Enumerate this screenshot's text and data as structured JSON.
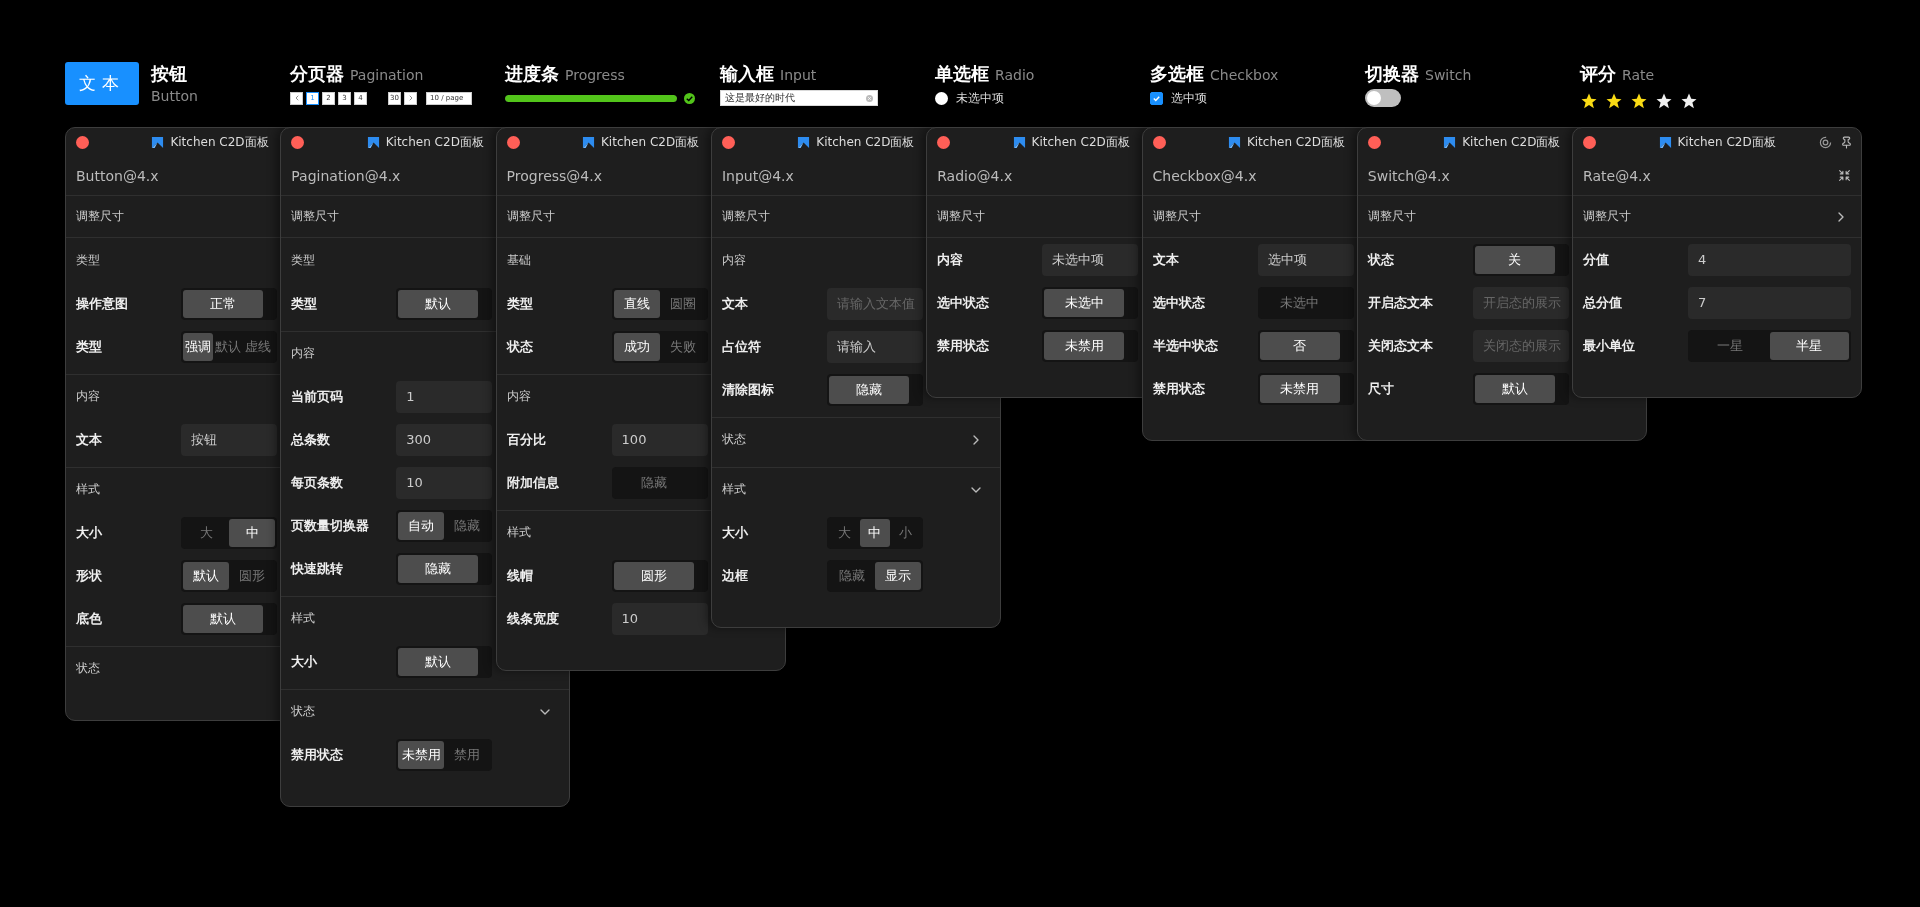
{
  "showcase": [
    {
      "kind": "button",
      "title": "按钮",
      "subtitle": "Button",
      "label": "文本"
    },
    {
      "kind": "pagination",
      "title": "分页器",
      "subtitle": "Pagination",
      "pages": [
        {
          "label": "1",
          "selected": true
        },
        {
          "label": "2",
          "selected": false
        },
        {
          "label": "3",
          "selected": false
        },
        {
          "label": "4",
          "selected": false
        },
        {
          "label": "30",
          "selected": false
        }
      ],
      "page_size": "10 / page"
    },
    {
      "kind": "progress",
      "title": "进度条",
      "subtitle": "Progress",
      "level": 1,
      "success": true
    },
    {
      "kind": "input",
      "title": "输入框",
      "subtitle": "Input",
      "value": "这是最好的时代"
    },
    {
      "kind": "radio",
      "title": "单选框",
      "subtitle": "Radio",
      "label": "未选中项",
      "checked": false
    },
    {
      "kind": "checkbox",
      "title": "多选框",
      "subtitle": "Checkbox",
      "label": "选中项",
      "checked": true
    },
    {
      "kind": "switch",
      "title": "切换器",
      "subtitle": "Switch",
      "on": false
    },
    {
      "kind": "rate",
      "title": "评分",
      "subtitle": "Rate",
      "stars": 3
    }
  ],
  "panels": [
    {
      "title": "Kitchen C2D面板",
      "component": "Button@4.x",
      "rows": [
        {
          "kind": "resize",
          "label": "调整尺寸"
        },
        {
          "kind": "group",
          "label": "类型"
        },
        {
          "kind": "segmented",
          "label": "操作意图",
          "options": [
            {
              "label": "正常",
              "selected": true
            }
          ]
        },
        {
          "kind": "chips",
          "label": "类型",
          "options": [
            {
              "label": "强调",
              "selected": true
            },
            {
              "label": "默认",
              "selected": false
            },
            {
              "label": "虚线",
              "selected": false
            }
          ]
        },
        {
          "kind": "group",
          "label": "内容"
        },
        {
          "kind": "field",
          "label": "文本",
          "value": "按钮"
        },
        {
          "kind": "group",
          "label": "样式"
        },
        {
          "kind": "segmented",
          "label": "大小",
          "options": [
            {
              "label": "大",
              "selected": false
            },
            {
              "label": "中",
              "selected": true
            }
          ]
        },
        {
          "kind": "segmented",
          "label": "形状",
          "options": [
            {
              "label": "默认",
              "selected": true
            },
            {
              "label": "圆形",
              "selected": false
            }
          ]
        },
        {
          "kind": "segmented",
          "label": "底色",
          "options": [
            {
              "label": "默认",
              "selected": true
            }
          ]
        },
        {
          "kind": "group",
          "label": "状态"
        }
      ]
    },
    {
      "title": "Kitchen C2D面板",
      "component": "Pagination@4.x",
      "rows": [
        {
          "kind": "resize",
          "label": "调整尺寸"
        },
        {
          "kind": "group",
          "label": "类型"
        },
        {
          "kind": "segmented",
          "label": "类型",
          "options": [
            {
              "label": "默认",
              "selected": true
            }
          ]
        },
        {
          "kind": "group",
          "label": "内容"
        },
        {
          "kind": "field",
          "label": "当前页码",
          "value": "1"
        },
        {
          "kind": "field",
          "label": "总条数",
          "value": "300"
        },
        {
          "kind": "field",
          "label": "每页条数",
          "value": "10"
        },
        {
          "kind": "segmented",
          "label": "页数量切换器",
          "options": [
            {
              "label": "自动",
              "selected": true
            },
            {
              "label": "隐藏",
              "selected": false
            }
          ]
        },
        {
          "kind": "segmented",
          "label": "快速跳转",
          "options": [
            {
              "label": "隐藏",
              "selected": true
            }
          ]
        },
        {
          "kind": "group",
          "label": "样式"
        },
        {
          "kind": "segmented",
          "label": "大小",
          "options": [
            {
              "label": "默认",
              "selected": true
            }
          ]
        },
        {
          "kind": "group",
          "label": "状态",
          "expanded": true
        },
        {
          "kind": "segmented",
          "label": "禁用状态",
          "options": [
            {
              "label": "未禁用",
              "selected": true
            },
            {
              "label": "禁用",
              "selected": false
            }
          ]
        }
      ]
    },
    {
      "title": "Kitchen C2D面板",
      "component": "Progress@4.x",
      "rows": [
        {
          "kind": "resize",
          "label": "调整尺寸"
        },
        {
          "kind": "group",
          "label": "基础"
        },
        {
          "kind": "segmented",
          "label": "类型",
          "options": [
            {
              "label": "直线",
              "selected": true
            },
            {
              "label": "圆圈",
              "selected": false
            }
          ]
        },
        {
          "kind": "segmented",
          "label": "状态",
          "options": [
            {
              "label": "成功",
              "selected": true
            },
            {
              "label": "失败",
              "selected": false
            }
          ]
        },
        {
          "kind": "group",
          "label": "内容"
        },
        {
          "kind": "field",
          "label": "百分比",
          "value": "100"
        },
        {
          "kind": "segmented",
          "label": "附加信息",
          "options": [
            {
              "label": "隐藏",
              "selected": false
            }
          ]
        },
        {
          "kind": "group",
          "label": "样式"
        },
        {
          "kind": "segmented",
          "label": "线帽",
          "options": [
            {
              "label": "圆形",
              "selected": true
            }
          ]
        },
        {
          "kind": "field",
          "label": "线条宽度",
          "value": "10"
        }
      ]
    },
    {
      "title": "Kitchen C2D面板",
      "component": "Input@4.x",
      "rows": [
        {
          "kind": "resize",
          "label": "调整尺寸"
        },
        {
          "kind": "group",
          "label": "内容"
        },
        {
          "kind": "field",
          "label": "文本",
          "placeholder": "请输入文本值"
        },
        {
          "kind": "field",
          "label": "占位符",
          "value": "请输入"
        },
        {
          "kind": "segmented",
          "label": "清除图标",
          "options": [
            {
              "label": "隐藏",
              "selected": true
            }
          ]
        },
        {
          "kind": "group",
          "label": "状态",
          "expanded": false
        },
        {
          "kind": "group",
          "label": "样式",
          "expanded": true
        },
        {
          "kind": "segmented",
          "label": "大小",
          "options": [
            {
              "label": "大",
              "selected": false
            },
            {
              "label": "中",
              "selected": true
            },
            {
              "label": "小",
              "selected": false
            }
          ]
        },
        {
          "kind": "segmented",
          "label": "边框",
          "options": [
            {
              "label": "隐藏",
              "selected": false
            },
            {
              "label": "显示",
              "selected": true
            }
          ]
        }
      ]
    },
    {
      "title": "Kitchen C2D面板",
      "component": "Radio@4.x",
      "rows": [
        {
          "kind": "resize",
          "label": "调整尺寸"
        },
        {
          "kind": "field",
          "label": "内容",
          "value": "未选中项"
        },
        {
          "kind": "segmented",
          "label": "选中状态",
          "options": [
            {
              "label": "未选中",
              "selected": true
            }
          ]
        },
        {
          "kind": "segmented",
          "label": "禁用状态",
          "options": [
            {
              "label": "未禁用",
              "selected": true
            }
          ]
        }
      ]
    },
    {
      "title": "Kitchen C2D面板",
      "component": "Checkbox@4.x",
      "rows": [
        {
          "kind": "resize",
          "label": "调整尺寸"
        },
        {
          "kind": "field",
          "label": "文本",
          "value": "选中项"
        },
        {
          "kind": "segmented",
          "label": "选中状态",
          "options": [
            {
              "label": "未选中",
              "selected": false
            }
          ]
        },
        {
          "kind": "segmented",
          "label": "半选中状态",
          "options": [
            {
              "label": "否",
              "selected": true
            }
          ]
        },
        {
          "kind": "segmented",
          "label": "禁用状态",
          "options": [
            {
              "label": "未禁用",
              "selected": true
            }
          ]
        }
      ]
    },
    {
      "title": "Kitchen C2D面板",
      "component": "Switch@4.x",
      "rows": [
        {
          "kind": "resize",
          "label": "调整尺寸"
        },
        {
          "kind": "segmented",
          "label": "状态",
          "options": [
            {
              "label": "关",
              "selected": true
            }
          ]
        },
        {
          "kind": "field",
          "label": "开启态文本",
          "placeholder": "开启态的展示"
        },
        {
          "kind": "field",
          "label": "关闭态文本",
          "placeholder": "关闭态的展示"
        },
        {
          "kind": "segmented",
          "label": "尺寸",
          "options": [
            {
              "label": "默认",
              "selected": true
            }
          ]
        }
      ]
    },
    {
      "title": "Kitchen C2D面板",
      "component": "Rate@4.x",
      "rows": [
        {
          "kind": "resize",
          "label": "调整尺寸",
          "expanded": false
        },
        {
          "kind": "field",
          "label": "分值",
          "value": "4"
        },
        {
          "kind": "field",
          "label": "总分值",
          "value": "7"
        },
        {
          "kind": "segmented",
          "label": "最小单位",
          "options": [
            {
              "label": "一星",
              "selected": false
            },
            {
              "label": "半星",
              "selected": true
            }
          ]
        }
      ]
    }
  ]
}
